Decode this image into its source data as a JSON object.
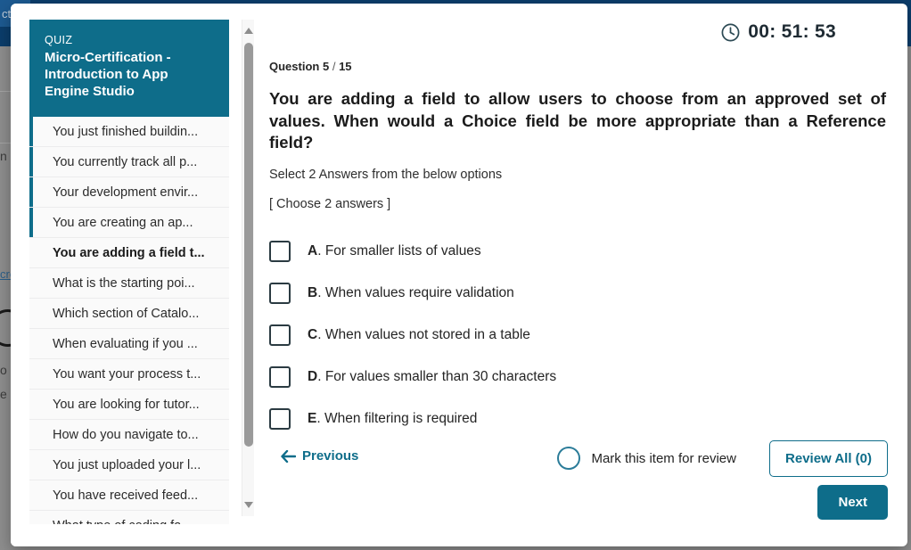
{
  "background": {
    "nav_fragment": "ct",
    "text_fragments": [
      "n",
      "o",
      "e S"
    ],
    "link_fragment": "cro"
  },
  "modal": {
    "quiz_card": {
      "kicker": "QUIZ",
      "title": "Micro-Certification - Introduction to App Engine Studio"
    },
    "question_list": [
      {
        "label": "You just finished buildin...",
        "answered": true,
        "current": false
      },
      {
        "label": "You currently track all p...",
        "answered": true,
        "current": false
      },
      {
        "label": "Your development envir...",
        "answered": true,
        "current": false
      },
      {
        "label": "You are creating an ap...",
        "answered": true,
        "current": false
      },
      {
        "label": "You are adding a field t...",
        "answered": false,
        "current": true
      },
      {
        "label": "What is the starting poi...",
        "answered": false,
        "current": false
      },
      {
        "label": "Which section of Catalo...",
        "answered": false,
        "current": false
      },
      {
        "label": "When evaluating if you ...",
        "answered": false,
        "current": false
      },
      {
        "label": "You want your process t...",
        "answered": false,
        "current": false
      },
      {
        "label": "You are looking for tutor...",
        "answered": false,
        "current": false
      },
      {
        "label": "How do you navigate to...",
        "answered": false,
        "current": false
      },
      {
        "label": "You just uploaded your l...",
        "answered": false,
        "current": false
      },
      {
        "label": "You have received feed...",
        "answered": false,
        "current": false
      },
      {
        "label": "What type of coding fa",
        "answered": false,
        "current": false
      }
    ],
    "timer": {
      "icon": "clock-icon",
      "value": "00: 51: 53"
    },
    "question": {
      "counter_prefix": "Question",
      "current": "5",
      "separator": "/",
      "total": "15",
      "text": "You are adding a field to allow users to choose from an approved set of values. When would a Choice field be more appropriate than a Reference field?",
      "select_instruction": "Select 2 Answers from the below options",
      "choose_instruction": "[ Choose 2 answers ]"
    },
    "options": [
      {
        "letter": "A",
        "text": "For smaller lists of values",
        "checked": false
      },
      {
        "letter": "B",
        "text": "When values require validation",
        "checked": false
      },
      {
        "letter": "C",
        "text": "When values not stored in a table",
        "checked": false
      },
      {
        "letter": "D",
        "text": "For values smaller than 30 characters",
        "checked": false
      },
      {
        "letter": "E",
        "text": "When filtering is required",
        "checked": false
      }
    ],
    "footer": {
      "previous_label": "Previous",
      "mark_label": "Mark this item for review",
      "review_all_label": "Review All (0)",
      "next_label": "Next"
    }
  },
  "colors": {
    "teal": "#0e6d8a",
    "nav_blue": "#0b3d6b",
    "text_dark": "#1b1b1b"
  }
}
